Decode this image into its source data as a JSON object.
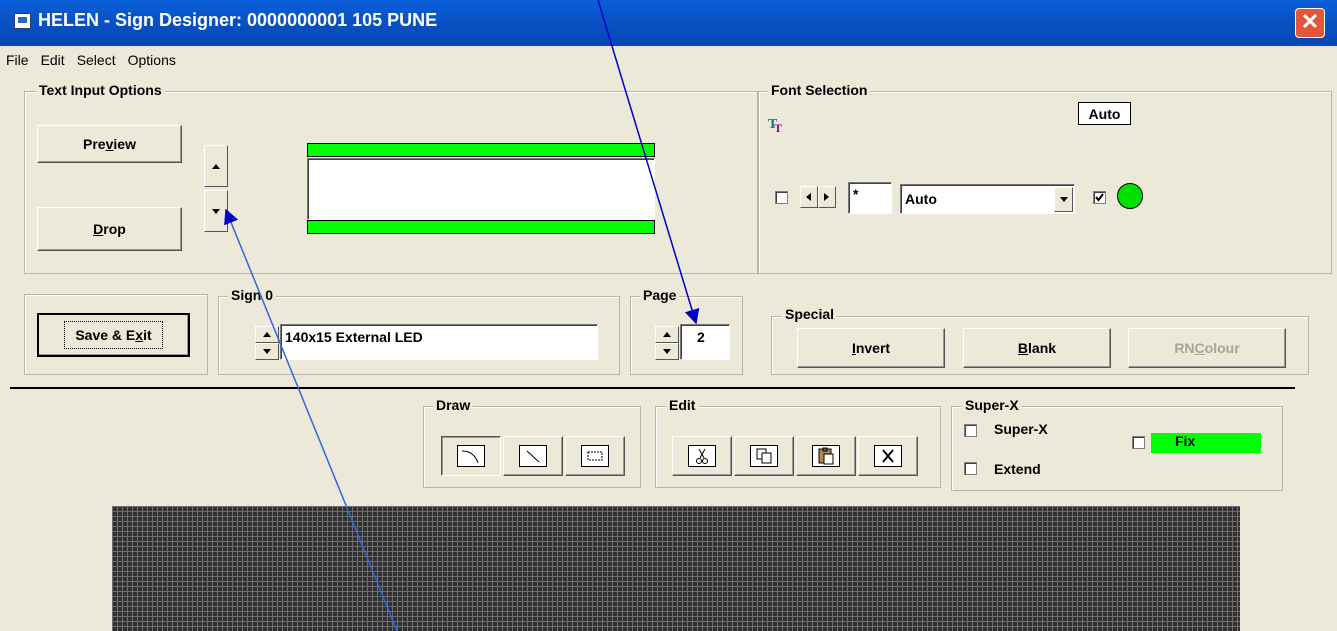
{
  "window": {
    "title": "HELEN - Sign Designer: 0000000001 105 PUNE",
    "close_glyph": "✕"
  },
  "menu": [
    "File",
    "Edit",
    "Select",
    "Options"
  ],
  "text_input_options": {
    "legend": "Text Input Options",
    "preview_pre": "Pre",
    "preview_u": "v",
    "preview_post": "iew",
    "drop_u": "D",
    "drop_post": "rop"
  },
  "font_selection": {
    "legend": "Font Selection",
    "icon": "font-tt-icon",
    "auto_label": "Auto",
    "size_value": "*",
    "font_value": "Auto",
    "checkbox_checked": true,
    "indicator_color": "#00e000"
  },
  "buttons": {
    "save_pre": "Save & E",
    "save_u": "x",
    "save_post": "it"
  },
  "sign": {
    "legend": "Sign 0",
    "value": "140x15 External LED"
  },
  "page": {
    "legend": "Page",
    "value": "2"
  },
  "special": {
    "legend": "Special",
    "invert_u": "I",
    "invert_post": "nvert",
    "blank_u": "B",
    "blank_post": "lank",
    "rn_pre": "RN ",
    "rn_u": "C",
    "rn_post": "olour"
  },
  "draw": {
    "legend": "Draw",
    "tools": [
      "arc-tool-icon",
      "line-tool-icon",
      "rectangle-tool-icon"
    ]
  },
  "edit": {
    "legend": "Edit",
    "tools": [
      "cut-icon",
      "copy-icon",
      "paste-icon",
      "delete-icon"
    ]
  },
  "superx": {
    "legend": "Super-X",
    "superx_label": "Super-X",
    "extend_label": "Extend",
    "fix_label": "Fix"
  },
  "colors": {
    "green": "#00ff00",
    "titlebar": "#0853c6",
    "arrow": "#0000cc"
  }
}
